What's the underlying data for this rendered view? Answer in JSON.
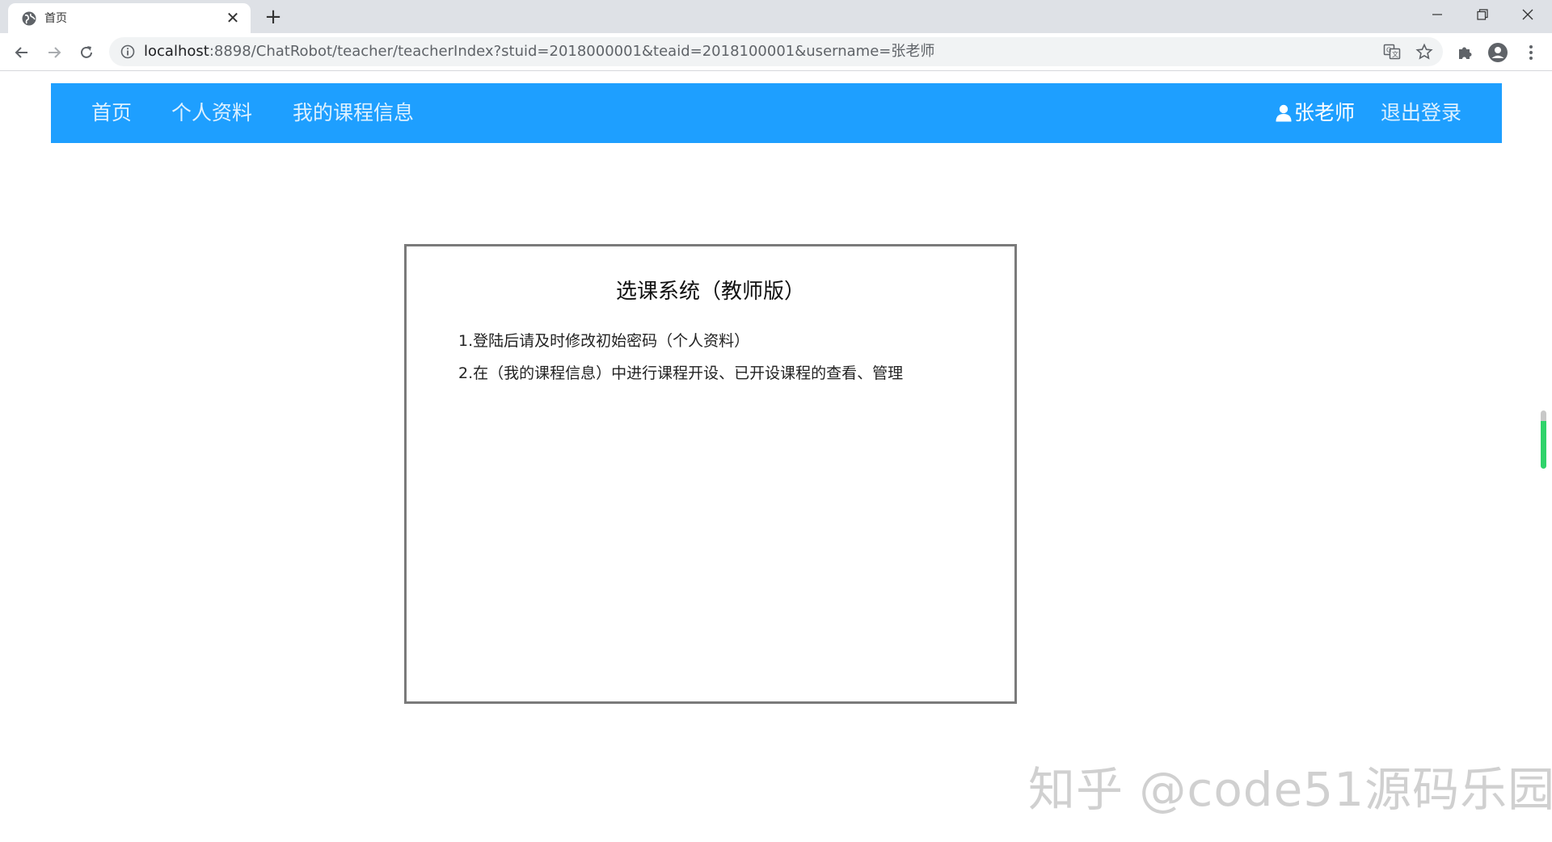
{
  "browser": {
    "tab": {
      "title": "首页",
      "close": "✕"
    },
    "new_tab": "+",
    "url": {
      "host": "localhost",
      "rest": ":8898/ChatRobot/teacher/teacherIndex?stuid=2018000001&teaid=2018100001&username=张老师"
    },
    "icons": {
      "favicon": "globe-icon",
      "back": "arrow-left-icon",
      "forward": "arrow-right-icon",
      "reload": "reload-icon",
      "info": "info-icon",
      "translate": "translate-icon",
      "bookmark": "star-icon",
      "extensions": "puzzle-icon",
      "profile": "account-icon",
      "menu": "kebab-menu-icon"
    }
  },
  "navbar": {
    "color": "#1e9fff",
    "items": [
      {
        "label": "首页"
      },
      {
        "label": "个人资料"
      },
      {
        "label": "我的课程信息"
      }
    ],
    "user": "张老师",
    "logout": "退出登录"
  },
  "panel": {
    "title": "选课系统（教师版）",
    "lines": [
      "1.登陆后请及时修改初始密码（个人资料）",
      "2.在（我的课程信息）中进行课程开设、已开设课程的查看、管理"
    ]
  },
  "watermark": "知乎 @code51源码乐园"
}
